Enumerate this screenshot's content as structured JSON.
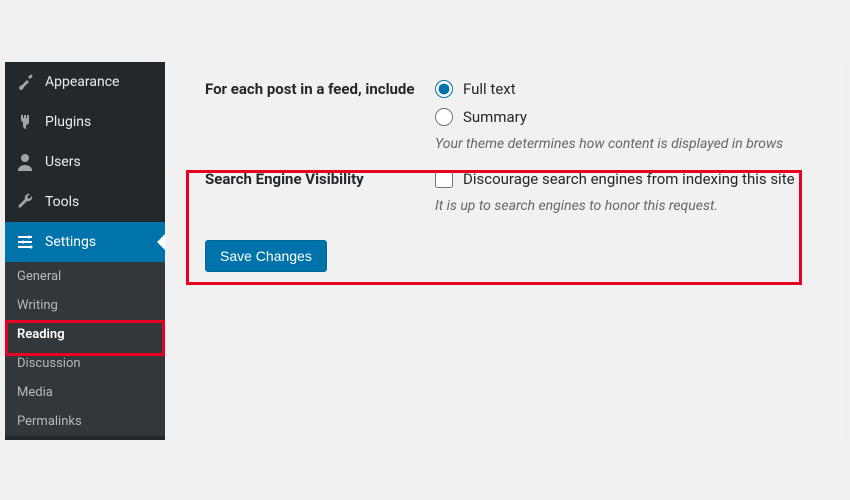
{
  "sidebar": {
    "items": [
      {
        "label": "Appearance"
      },
      {
        "label": "Plugins"
      },
      {
        "label": "Users"
      },
      {
        "label": "Tools"
      },
      {
        "label": "Settings"
      }
    ],
    "submenu": [
      {
        "label": "General"
      },
      {
        "label": "Writing"
      },
      {
        "label": "Reading"
      },
      {
        "label": "Discussion"
      },
      {
        "label": "Media"
      },
      {
        "label": "Permalinks"
      }
    ]
  },
  "content": {
    "feed_label": "For each post in a feed, include",
    "radio_full": "Full text",
    "radio_summary": "Summary",
    "feed_hint": "Your theme determines how content is displayed in brows",
    "visibility_label": "Search Engine Visibility",
    "visibility_check": "Discourage search engines from indexing this site",
    "visibility_hint": "It is up to search engines to honor this request.",
    "save_button": "Save Changes"
  }
}
